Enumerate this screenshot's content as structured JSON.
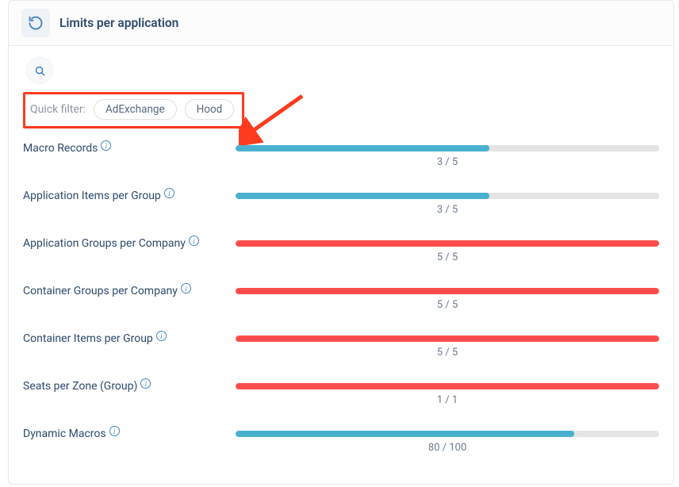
{
  "header": {
    "title": "Limits per application"
  },
  "quick_filter": {
    "label": "Quick filter:",
    "chips": [
      "AdExchange",
      "Hood"
    ]
  },
  "limits": [
    {
      "label": "Macro Records",
      "used": 3,
      "max": 5,
      "count_text": "3 / 5",
      "color": "blue"
    },
    {
      "label": "Application Items per Group",
      "used": 3,
      "max": 5,
      "count_text": "3 / 5",
      "color": "blue"
    },
    {
      "label": "Application Groups per Company",
      "used": 5,
      "max": 5,
      "count_text": "5 / 5",
      "color": "red"
    },
    {
      "label": "Container Groups per Company",
      "used": 5,
      "max": 5,
      "count_text": "5 / 5",
      "color": "red"
    },
    {
      "label": "Container Items per Group",
      "used": 5,
      "max": 5,
      "count_text": "5 / 5",
      "color": "red"
    },
    {
      "label": "Seats per Zone (Group)",
      "used": 1,
      "max": 1,
      "count_text": "1 / 1",
      "color": "red"
    },
    {
      "label": "Dynamic Macros",
      "used": 80,
      "max": 100,
      "count_text": "80 / 100",
      "color": "blue"
    }
  ]
}
